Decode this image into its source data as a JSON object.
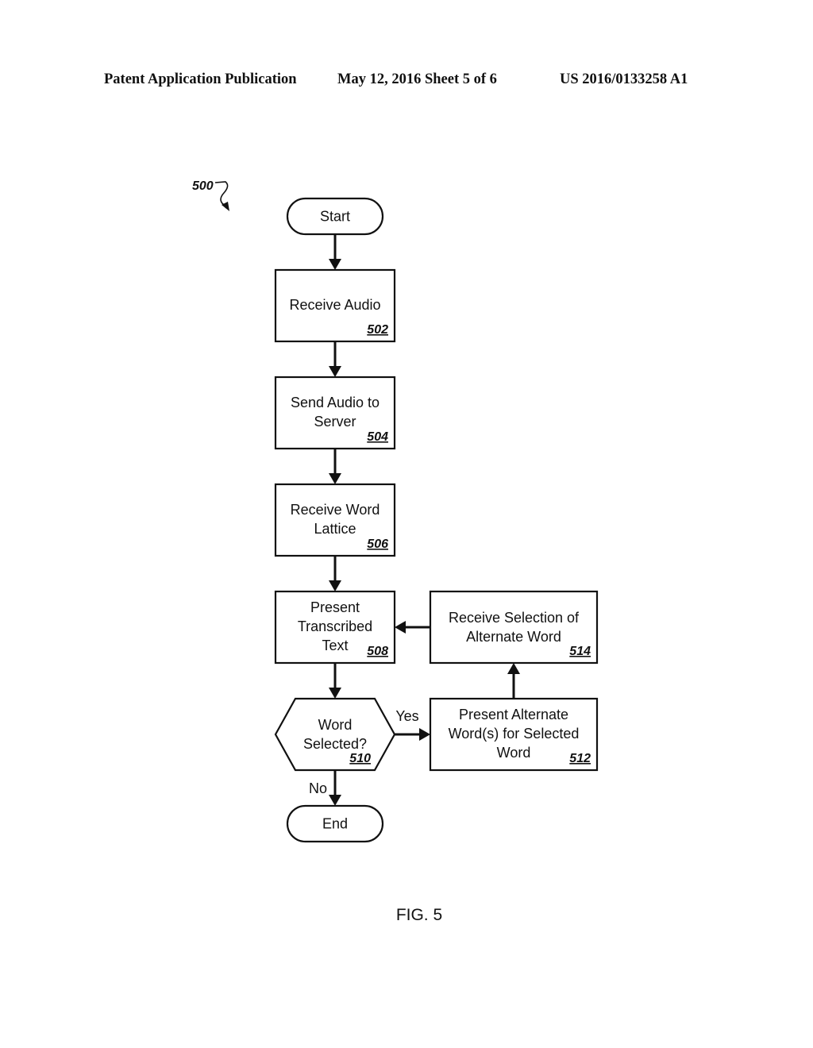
{
  "header": {
    "left": "Patent Application Publication",
    "middle": "May 12, 2016  Sheet 5 of 6",
    "right": "US 2016/0133258 A1"
  },
  "figure": {
    "ref_number": "500",
    "caption": "FIG. 5",
    "nodes": {
      "start": {
        "type": "terminal",
        "lines": [
          "Start"
        ]
      },
      "n502": {
        "type": "process",
        "lines": [
          "Receive Audio"
        ],
        "ref": "502"
      },
      "n504": {
        "type": "process",
        "lines": [
          "Send Audio to",
          "Server"
        ],
        "ref": "504"
      },
      "n506": {
        "type": "process",
        "lines": [
          "Receive Word",
          "Lattice"
        ],
        "ref": "506"
      },
      "n508": {
        "type": "process",
        "lines": [
          "Present",
          "Transcribed",
          "Text"
        ],
        "ref": "508"
      },
      "n510": {
        "type": "decision",
        "lines": [
          "Word",
          "Selected?"
        ],
        "ref": "510"
      },
      "n512": {
        "type": "process",
        "lines": [
          "Present Alternate",
          "Word(s) for Selected",
          "Word"
        ],
        "ref": "512"
      },
      "n514": {
        "type": "process",
        "lines": [
          "Receive Selection of",
          "Alternate Word"
        ],
        "ref": "514"
      },
      "end": {
        "type": "terminal",
        "lines": [
          "End"
        ]
      }
    },
    "edges": [
      {
        "from": "start",
        "to": "n502",
        "label": ""
      },
      {
        "from": "n502",
        "to": "n504",
        "label": ""
      },
      {
        "from": "n504",
        "to": "n506",
        "label": ""
      },
      {
        "from": "n506",
        "to": "n508",
        "label": ""
      },
      {
        "from": "n508",
        "to": "n510",
        "label": ""
      },
      {
        "from": "n510",
        "to": "n512",
        "label": "Yes"
      },
      {
        "from": "n510",
        "to": "end",
        "label": "No"
      },
      {
        "from": "n512",
        "to": "n514",
        "label": ""
      },
      {
        "from": "n514",
        "to": "n508",
        "label": ""
      }
    ]
  }
}
